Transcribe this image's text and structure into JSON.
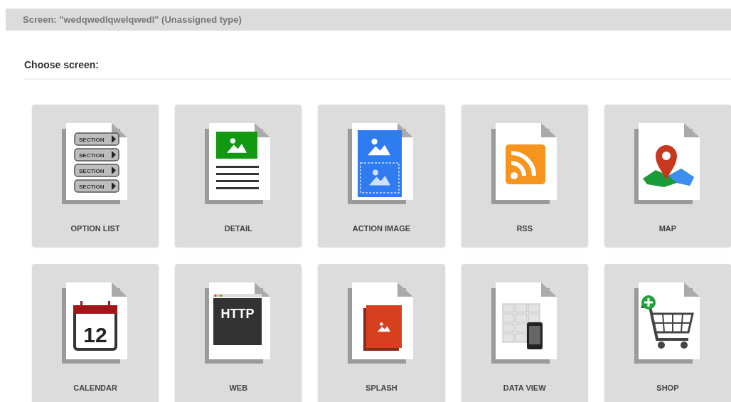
{
  "header": {
    "title": "Screen: \"wedqwedlqwelqwedl\" (Unassigned type)"
  },
  "section": {
    "heading": "Choose screen:"
  },
  "tiles": [
    {
      "kind": "option_list",
      "label": "OPTION LIST",
      "icon_texts": [
        "SECTION",
        "SECTION",
        "SECTION",
        "SECTION"
      ]
    },
    {
      "kind": "detail",
      "label": "DETAIL"
    },
    {
      "kind": "action_image",
      "label": "ACTION IMAGE"
    },
    {
      "kind": "rss",
      "label": "RSS"
    },
    {
      "kind": "map",
      "label": "MAP"
    },
    {
      "kind": "calendar",
      "label": "CALENDAR",
      "icon_texts": [
        "12"
      ]
    },
    {
      "kind": "web",
      "label": "WEB",
      "icon_texts": [
        "HTTP"
      ]
    },
    {
      "kind": "splash",
      "label": "SPLASH"
    },
    {
      "kind": "data_view",
      "label": "DATA VIEW"
    },
    {
      "kind": "shop",
      "label": "SHOP"
    }
  ]
}
